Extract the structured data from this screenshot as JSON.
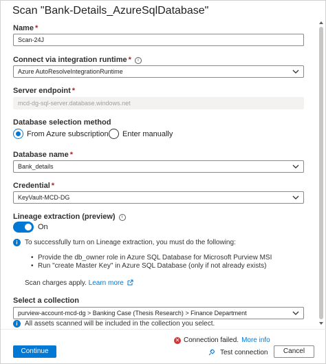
{
  "header": {
    "title": "Scan \"Bank-Details_AzureSqlDatabase\""
  },
  "fields": {
    "name": {
      "label": "Name",
      "required_mark": "*",
      "value": "Scan-24J"
    },
    "runtime": {
      "label": "Connect via integration runtime",
      "required_mark": "*",
      "info_glyph": "i",
      "value": "Azure AutoResolveIntegrationRuntime"
    },
    "server": {
      "label": "Server endpoint",
      "required_mark": "*",
      "value": "mcd-dg-sql-server.database.windows.net"
    },
    "db_method": {
      "label": "Database selection method",
      "options": [
        {
          "label": "From Azure subscription",
          "selected": true
        },
        {
          "label": "Enter manually",
          "selected": false
        }
      ]
    },
    "db_name": {
      "label": "Database name",
      "required_mark": "*",
      "value": "Bank_details"
    },
    "credential": {
      "label": "Credential",
      "required_mark": "*",
      "value": "KeyVault-MCD-DG"
    },
    "lineage": {
      "label": "Lineage extraction (preview)",
      "info_glyph": "i",
      "toggle_state": "On"
    },
    "collection": {
      "label": "Select a collection",
      "value": "purview-account-mcd-dg > Banking Case (Thesis Research) > Finance Department"
    }
  },
  "lineage_notes": {
    "intro": "To successfully turn on Lineage extraction, you must do the following:",
    "bullets": [
      "Provide the db_owner role in Azure SQL Database for Microsoft Purview MSI",
      "Run \"create Master Key\" in Azure SQL Database (only if not already exists)"
    ],
    "charges_text": "Scan charges apply.",
    "learn_more": "Learn more"
  },
  "collection_note": "All assets scanned will be included in the collection you select.",
  "footer": {
    "continue_label": "Continue",
    "status_text": "Connection failed.",
    "more_info": "More info",
    "test_connection": "Test connection",
    "cancel_label": "Cancel"
  },
  "icons": {
    "info": "info-circle-icon",
    "error": "error-circle-icon",
    "plug": "plug-icon",
    "external": "external-link-icon",
    "chevron": "chevron-down-icon"
  },
  "colors": {
    "accent": "#0078d4",
    "required": "#a4262c",
    "error": "#d13438"
  }
}
